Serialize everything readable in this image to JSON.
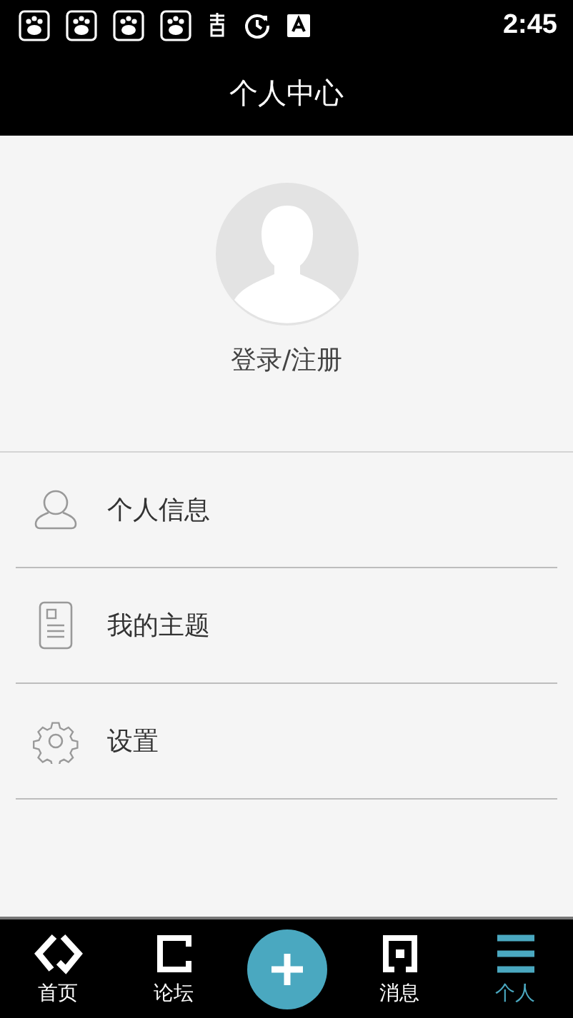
{
  "status_bar": {
    "notifications": [
      {
        "kind": "paw"
      },
      {
        "kind": "paw"
      },
      {
        "kind": "paw"
      },
      {
        "kind": "paw"
      },
      {
        "kind": "book"
      },
      {
        "kind": "sync"
      },
      {
        "kind": "font"
      }
    ],
    "time": "2:45"
  },
  "header": {
    "title": "个人中心"
  },
  "profile": {
    "login_label": "登录/注册"
  },
  "menu": [
    {
      "kind": "person",
      "label": "个人信息"
    },
    {
      "kind": "document",
      "label": "我的主题"
    },
    {
      "kind": "gear",
      "label": "设置"
    }
  ],
  "nav": [
    {
      "kind": "home",
      "label": "首页",
      "selected": false
    },
    {
      "kind": "forum",
      "label": "论坛",
      "selected": false
    },
    {
      "kind": "add"
    },
    {
      "kind": "message",
      "label": "消息",
      "selected": false
    },
    {
      "kind": "profile",
      "label": "个人",
      "selected": true
    }
  ]
}
